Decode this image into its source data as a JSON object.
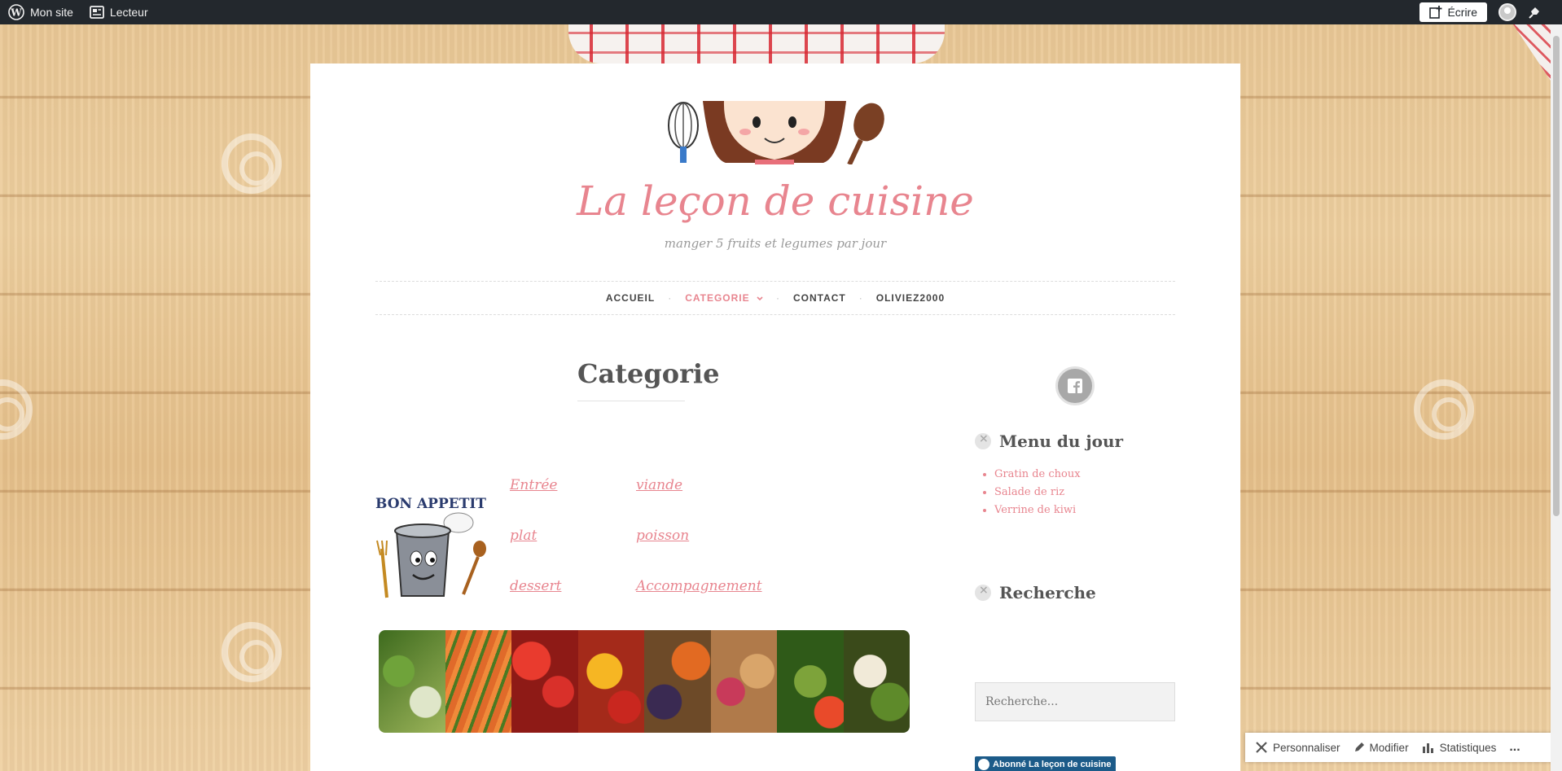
{
  "adminbar": {
    "site_label": "Mon site",
    "reader_label": "Lecteur",
    "write_label": "Écrire"
  },
  "site": {
    "title": "La leçon de cuisine",
    "tagline": "manger 5 fruits et legumes par jour"
  },
  "nav": {
    "items": [
      {
        "label": "ACCUEIL"
      },
      {
        "label": "CATEGORIE"
      },
      {
        "label": "CONTACT"
      },
      {
        "label": "OLIVIEZ2000"
      }
    ],
    "separator": "·"
  },
  "page": {
    "title": "Categorie",
    "links": [
      "Entrée",
      "viande",
      "plat",
      "poisson",
      "dessert",
      "Accompagnement"
    ]
  },
  "sidebar": {
    "menu_widget_title": "Menu du jour",
    "menu_items": [
      "Gratin de choux",
      "Salade de riz",
      "Verrine de kiwi"
    ],
    "search_widget_title": "Recherche",
    "search_placeholder": "Recherche...",
    "subscribe_label": "Abonné La leçon de cuisine"
  },
  "bottom_bar": {
    "customize_label": "Personnaliser",
    "edit_label": "Modifier",
    "stats_label": "Statistiques",
    "more_label": "..."
  },
  "colors": {
    "accent": "#e8858f",
    "admin_bg": "#23282d",
    "subscribe_bg": "#1c5b89"
  }
}
